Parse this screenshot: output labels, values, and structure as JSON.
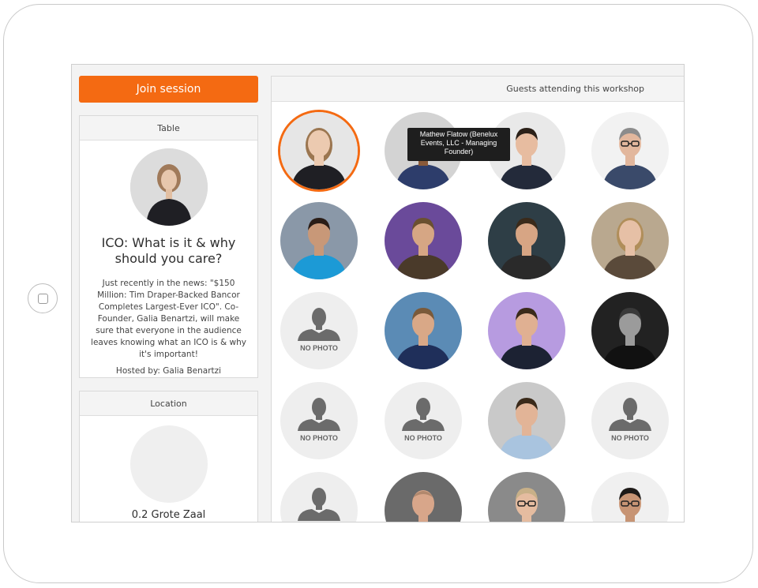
{
  "join_button": {
    "label": "Join session",
    "color": "#f46a12"
  },
  "table_card": {
    "header": "Table",
    "title": "ICO: What is it & why should you care?",
    "description": "Just recently in the news: \"$150 Million: Tim Draper-Backed Bancor Completes Largest-Ever ICO\". Co-Founder, Galia Benartzi, will make sure that everyone in the audience leaves knowing what an ICO is & why it's important!",
    "host_line": "Hosted by: Galia Benartzi"
  },
  "location_card": {
    "header": "Location",
    "name": "0.2 Grote Zaal"
  },
  "guests_panel": {
    "header": "Guests attending this workshop",
    "no_photo_label": "NO PHOTO",
    "guests": [
      {
        "photo": "woman-blonde-dark-top",
        "selected": true
      },
      {
        "photo": "man-glasses-navy-suit"
      },
      {
        "photo": "man-suit-tie"
      },
      {
        "photo": "man-glasses-grey-hair"
      },
      {
        "photo": "man-blue-hoodie"
      },
      {
        "photo": "man-beard-purple-bg"
      },
      {
        "photo": "man-smiling-dark-bg",
        "tooltip": "Mathew Flatow (Benelux Events, LLC - Managing Founder)"
      },
      {
        "photo": "woman-blonde-smiling"
      },
      {
        "photo": "no-photo"
      },
      {
        "photo": "man-polo-beach"
      },
      {
        "photo": "man-stage-purple"
      },
      {
        "photo": "man-curly-hair-bw"
      },
      {
        "photo": "no-photo"
      },
      {
        "photo": "no-photo"
      },
      {
        "photo": "man-light-blue-shirt"
      },
      {
        "photo": "no-photo"
      },
      {
        "photo": "no-photo"
      },
      {
        "photo": "man-bald-beard"
      },
      {
        "photo": "man-glasses-blonde"
      },
      {
        "photo": "man-glasses-dark-hair"
      }
    ]
  },
  "colors": {
    "accent": "#f46a12",
    "selected_ring": "#f46a12"
  }
}
